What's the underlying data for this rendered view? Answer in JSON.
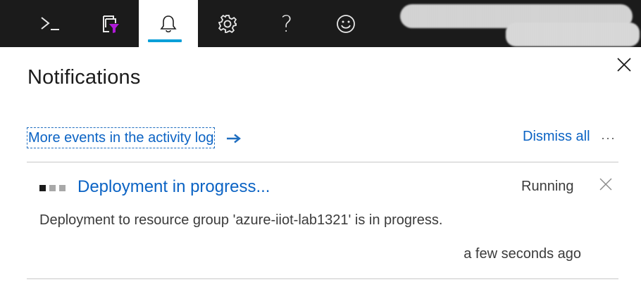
{
  "topbar": {
    "buttons": [
      {
        "icon": "cloud-shell-icon"
      },
      {
        "icon": "directory-filter-icon"
      },
      {
        "icon": "bell-icon",
        "active": true
      },
      {
        "icon": "gear-icon"
      },
      {
        "icon": "help-icon",
        "glyph": "?"
      },
      {
        "icon": "smiley-icon"
      }
    ],
    "accent_color": "#0a9fd8",
    "filter_accent": "#b01bd8"
  },
  "panel": {
    "title": "Notifications",
    "activity_link": "More events in the activity log",
    "dismiss_all": "Dismiss all"
  },
  "notification": {
    "title": "Deployment in progress...",
    "status": "Running",
    "description": "Deployment to resource group 'azure-iiot-lab1321' is in progress.",
    "timestamp": "a few seconds ago"
  }
}
